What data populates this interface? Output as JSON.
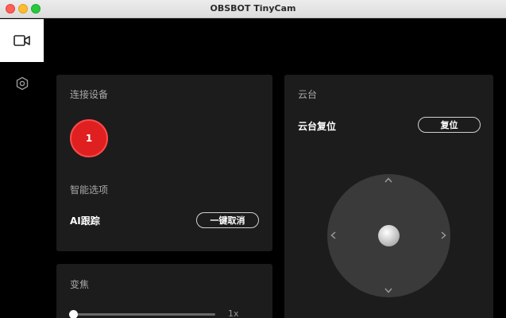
{
  "window": {
    "title": "OBSBOT TinyCam"
  },
  "sidebar": {
    "items": [
      {
        "icon": "video-camera-icon",
        "active": true
      },
      {
        "icon": "hexagon-settings-icon",
        "active": false
      }
    ]
  },
  "connect_panel": {
    "title": "连接设备",
    "device_number": "1",
    "smart_title": "智能选项",
    "ai_tracking_label": "AI跟踪",
    "cancel_button": "一键取消"
  },
  "zoom_panel": {
    "title": "变焦",
    "value": "1x",
    "level": 0
  },
  "gimbal_panel": {
    "title": "云台",
    "reset_label": "云台复位",
    "reset_button": "复位"
  },
  "colors": {
    "accent_red": "#e02020",
    "panel_bg": "#1c1c1c",
    "app_bg": "#000000"
  }
}
